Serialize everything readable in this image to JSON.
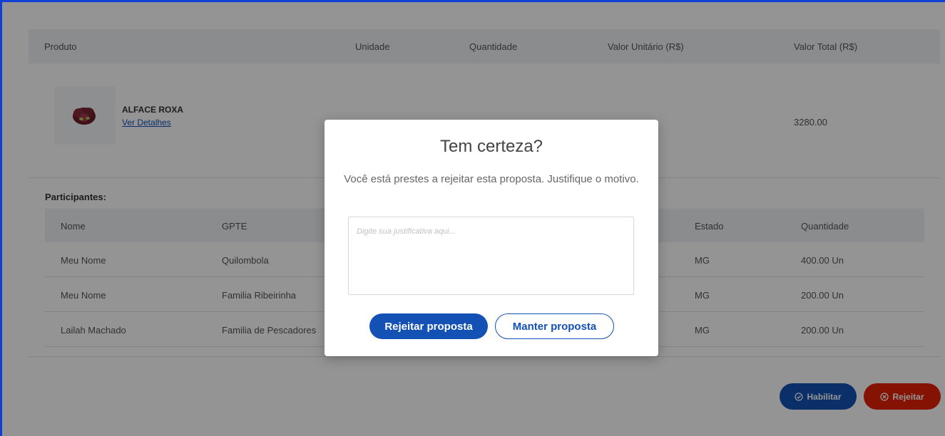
{
  "table": {
    "headers": {
      "produto": "Produto",
      "unidade": "Unidade",
      "quantidade": "Quantidade",
      "valor_unitario": "Valor Unitário (R$)",
      "valor_total": "Valor Total (R$)"
    },
    "product": {
      "name": "ALFACE ROXA",
      "details_link": "Ver Detalhes",
      "valor_total": "3280.00"
    }
  },
  "participants": {
    "title": "Participantes:",
    "headers": {
      "nome": "Nome",
      "gpte": "GPTE",
      "estado": "Estado",
      "quantidade": "Quantidade"
    },
    "rows": [
      {
        "nome": "Meu Nome",
        "gpte": "Quilombola",
        "estado": "MG",
        "quantidade": "400.00 Un"
      },
      {
        "nome": "Meu Nome",
        "gpte": "Familia Ribeirinha",
        "estado": "MG",
        "quantidade": "200.00 Un"
      },
      {
        "nome": "Lailah Machado",
        "gpte": "Familia de Pescadores",
        "estado": "MG",
        "quantidade": "200.00 Un"
      }
    ]
  },
  "actions": {
    "habilitar": "Habilitar",
    "rejeitar": "Rejeitar"
  },
  "modal": {
    "title": "Tem certeza?",
    "text": "Você está prestes a rejeitar esta proposta. Justifique o motivo.",
    "placeholder": "Digite sua justificativa aqui...",
    "confirm": "Rejeitar proposta",
    "cancel": "Manter proposta"
  },
  "colors": {
    "primary": "#1351b4",
    "danger": "#e52207",
    "frame_border": "#1240d6"
  }
}
